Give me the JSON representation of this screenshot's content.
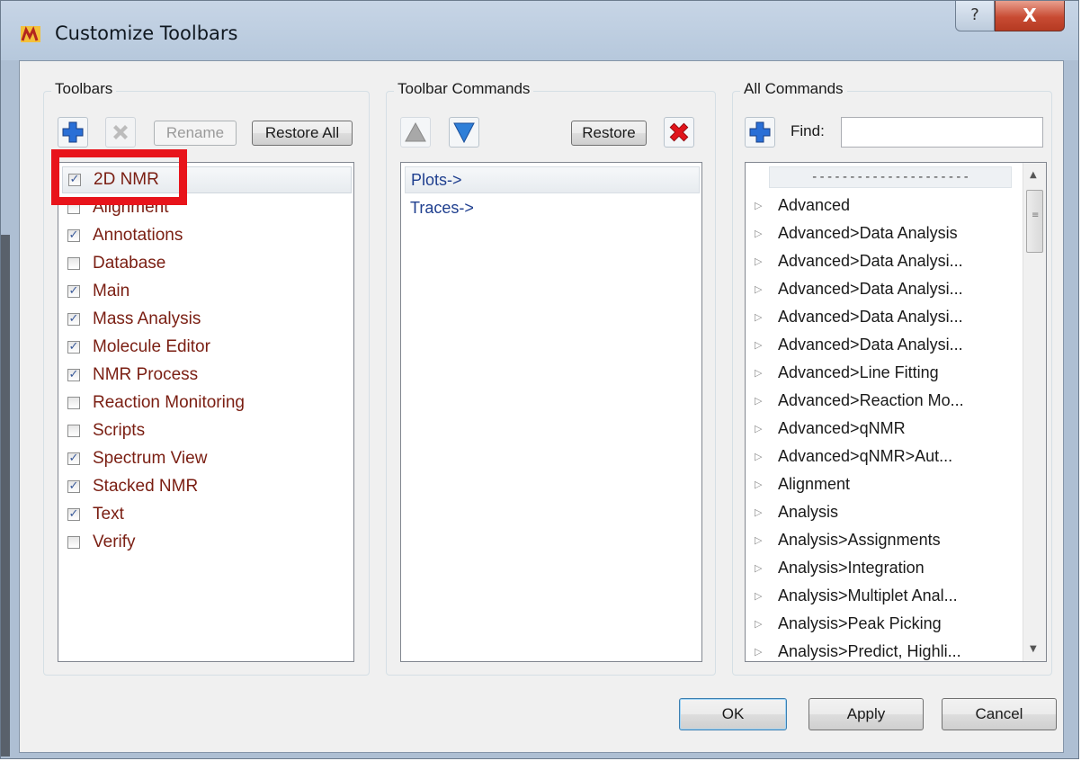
{
  "window": {
    "title": "Customize Toolbars",
    "help_glyph": "?",
    "close_glyph": "X"
  },
  "toolbars_group": {
    "label": "Toolbars",
    "rename_label": "Rename",
    "restore_all_label": "Restore All",
    "items": [
      {
        "label": "2D NMR",
        "checked": true
      },
      {
        "label": "Alignment",
        "checked": false
      },
      {
        "label": "Annotations",
        "checked": true
      },
      {
        "label": "Database",
        "checked": false
      },
      {
        "label": "Main",
        "checked": true
      },
      {
        "label": "Mass Analysis",
        "checked": true
      },
      {
        "label": "Molecule Editor",
        "checked": true
      },
      {
        "label": "NMR Process",
        "checked": true
      },
      {
        "label": "Reaction Monitoring",
        "checked": false
      },
      {
        "label": "Scripts",
        "checked": false
      },
      {
        "label": "Spectrum View",
        "checked": true
      },
      {
        "label": "Stacked NMR",
        "checked": true
      },
      {
        "label": "Text",
        "checked": true
      },
      {
        "label": "Verify",
        "checked": false
      }
    ]
  },
  "toolbar_commands_group": {
    "label": "Toolbar Commands",
    "restore_label": "Restore",
    "items": [
      "Plots->",
      "Traces->"
    ]
  },
  "all_commands_group": {
    "label": "All Commands",
    "find_label": "Find:",
    "find_value": "",
    "separator": "---------------------",
    "items": [
      "Advanced",
      "Advanced>Data Analysis",
      "Advanced>Data Analysi...",
      "Advanced>Data Analysi...",
      "Advanced>Data Analysi...",
      "Advanced>Data Analysi...",
      "Advanced>Line Fitting",
      "Advanced>Reaction Mo...",
      "Advanced>qNMR",
      "Advanced>qNMR>Aut...",
      "Alignment",
      "Analysis",
      "Analysis>Assignments",
      "Analysis>Integration",
      "Analysis>Multiplet Anal...",
      "Analysis>Peak Picking",
      "Analysis>Predict, Highli..."
    ]
  },
  "footer": {
    "ok_label": "OK",
    "apply_label": "Apply",
    "cancel_label": "Cancel"
  },
  "colors": {
    "toolbar_item_text": "#7a1e12",
    "command_text": "#1f3f8f",
    "highlight": "#e8141b"
  }
}
